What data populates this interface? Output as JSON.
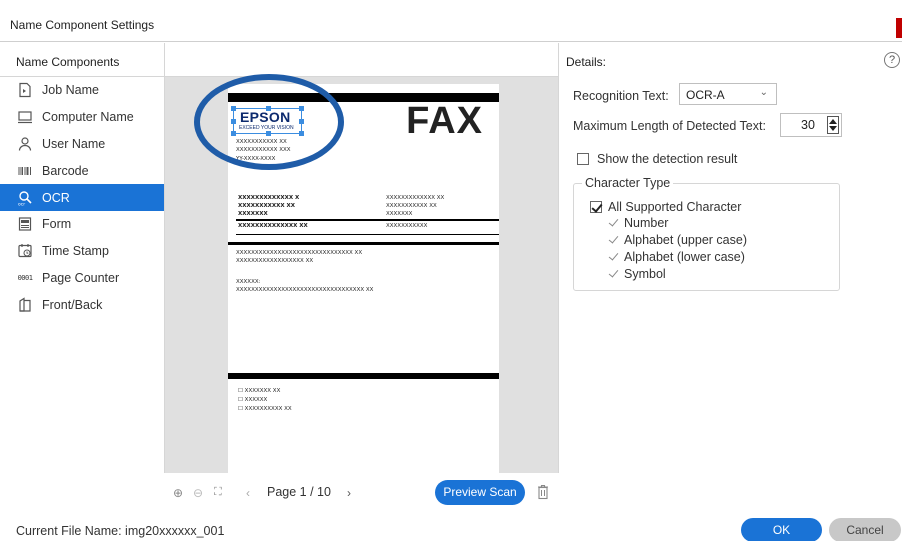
{
  "window": {
    "title": "Name Component Settings"
  },
  "sidebar": {
    "header": "Name Components",
    "items": [
      {
        "label": "Job Name",
        "icon": "job-name-icon",
        "active": false
      },
      {
        "label": "Computer Name",
        "icon": "computer-icon",
        "active": false
      },
      {
        "label": "User Name",
        "icon": "user-icon",
        "active": false
      },
      {
        "label": "Barcode",
        "icon": "barcode-icon",
        "active": false
      },
      {
        "label": "OCR",
        "icon": "ocr-icon",
        "active": true
      },
      {
        "label": "Form",
        "icon": "form-icon",
        "active": false
      },
      {
        "label": "Time Stamp",
        "icon": "time-stamp-icon",
        "active": false
      },
      {
        "label": "Page Counter",
        "icon": "page-counter-icon",
        "icon_text": "0001",
        "active": false
      },
      {
        "label": "Front/Back",
        "icon": "front-back-icon",
        "active": false
      }
    ]
  },
  "preview": {
    "fax_title": "FAX",
    "logo_text": "EPSON",
    "logo_tagline": "EXCEED YOUR VISION",
    "header_lines": [
      "XXXXXXXXXXX XX",
      "XXXXXXXXXXX XXX",
      "YY-XXXX-XXXX"
    ],
    "left_block": [
      "XXXXXXXXXXXXX X",
      "XXXXXXXXXXX XX",
      "XXXXXXX"
    ],
    "right_block": [
      "XXXXXXXXXXXXX XX",
      "XXXXXXXXXXX XX",
      "XXXXXXX"
    ],
    "left_row4": "XXXXXXXXXXXXXX XX",
    "right_row4": "XXXXXXXXXXX",
    "body_lines": [
      "XXXXXXXXXXXXXXXXXXXXXXXXXXXXXXX XX",
      "XXXXXXXXXXXXXXXXXX XX",
      "XXXXXX:",
      "XXXXXXXXXXXXXXXXXXXXXXXXXXXXXXXXXX XX"
    ],
    "checkbox_lines": [
      "☐ XXXXXXX XX",
      "☐ XXXXXX",
      "☐ XXXXXXXXXX XX"
    ],
    "page_indicator": "Page 1 / 10",
    "preview_scan_label": "Preview Scan"
  },
  "details": {
    "header": "Details:",
    "recognition_text_label": "Recognition Text:",
    "recognition_text_value": "OCR-A",
    "max_length_label": "Maximum Length of Detected Text:",
    "max_length_value": "30",
    "show_detection_label": "Show the detection result",
    "show_detection_checked": false,
    "character_type_title": "Character Type",
    "all_supported_label": "All Supported Character",
    "all_supported_checked": true,
    "options": [
      {
        "label": "Number",
        "checked": true
      },
      {
        "label": "Alphabet (upper case)",
        "checked": true
      },
      {
        "label": "Alphabet (lower case)",
        "checked": true
      },
      {
        "label": "Symbol",
        "checked": true
      }
    ]
  },
  "footer": {
    "current_file_label": "Current File Name: img20xxxxxx_001",
    "ok_label": "OK",
    "cancel_label": "Cancel"
  },
  "colors": {
    "accent": "#1a73d6",
    "ocr_highlight": "#1f5ca8",
    "close_red": "#c00000"
  }
}
